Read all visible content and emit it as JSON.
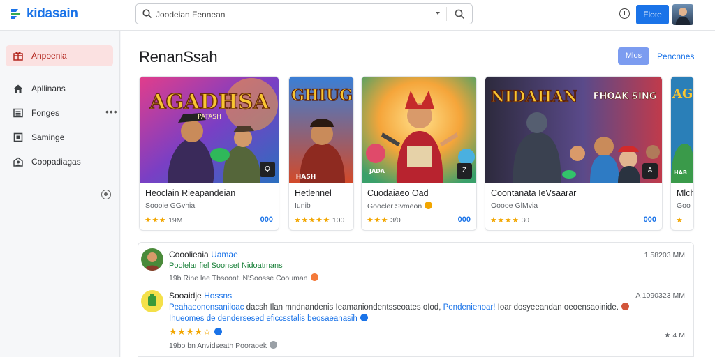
{
  "app": {
    "name": "kidasain",
    "brand_color": "#1a73e8",
    "accent_color": "#b3261e"
  },
  "search": {
    "value": "Joodeian Fennean",
    "placeholder": "",
    "icon": "search-icon"
  },
  "topbar": {
    "info_icon": "info-icon",
    "action_label": "Flote",
    "avatar": "user-avatar"
  },
  "sidebar": {
    "items": [
      {
        "label": "Anpoenia",
        "icon": "gift-icon",
        "active": true
      },
      {
        "label": "Apllinans",
        "icon": "home-icon",
        "active": false
      },
      {
        "label": "Fonges",
        "icon": "list-icon",
        "active": false,
        "more": "•••"
      },
      {
        "label": "Saminge",
        "icon": "square-icon",
        "active": false
      },
      {
        "label": "Coopadiagas",
        "icon": "account-icon",
        "active": false
      }
    ]
  },
  "main": {
    "title": "RenanSsah",
    "chip_label": "Mlos",
    "link_label": "Pencnnes"
  },
  "cards": [
    {
      "art_title": "AGADHSA",
      "art_sub": "PATASH",
      "title": "Heoclain Rieapandeian",
      "subtitle": "Soooie GGvhia",
      "stars": "★★★",
      "rating": "19M",
      "price": "000",
      "badge": "Q"
    },
    {
      "art_title": "GHIUG",
      "art_sub": "HASH",
      "title": "Hetlennel",
      "subtitle": "Iunib",
      "stars": "★★★★★",
      "rating": "100",
      "price": "",
      "badge": ""
    },
    {
      "art_title": "",
      "art_sub": "JADA",
      "title": "Cuodaiaeo Oad",
      "subtitle": "Goocler Svmeon",
      "stars": "★★★",
      "rating": "3/0",
      "price": "000",
      "badge": "Z"
    },
    {
      "art_title": "NIDAHAN",
      "art_sub": "FHOAK SING",
      "title": "Coontanata IeVsaarar",
      "subtitle": "Ooooe GlMvia",
      "stars": "★★★★",
      "rating": "30",
      "price": "000",
      "badge": "A"
    },
    {
      "art_title": "AG",
      "art_sub": "HAB",
      "title": "Mlch",
      "subtitle": "Goo",
      "stars": "★",
      "rating": "",
      "price": "",
      "badge": ""
    }
  ],
  "reviews": [
    {
      "name": "Cooolieaia",
      "name_link": "Uamae",
      "time": "1 58203 MM",
      "green": "Poolelar fiel Soonset Nidoatmans",
      "meta": "19b Rine lae Tbsoont. N'Soosse Coouman",
      "avatar": "reviewer-avatar"
    },
    {
      "name": "Sooaidje",
      "name_link": "Hossns",
      "time": "A 1090323 MM",
      "body_start": "Peahaeononsaniloac",
      "body_mid": "dacsh Ilan mndnandenis Ieamaniondentsseoates oIod,",
      "body_link": "Pendenienoar!",
      "body_end": "Ioar dosyeeandan oeoensaoinide.",
      "body2": "Ihueomes de dendersesed eficcsstalis beosaeanasih",
      "stars": "★★★★☆",
      "flag": "★ 4 M",
      "meta": "19bo bn Anvidseath Pooraoek",
      "avatar": "reviewer-avatar"
    }
  ]
}
